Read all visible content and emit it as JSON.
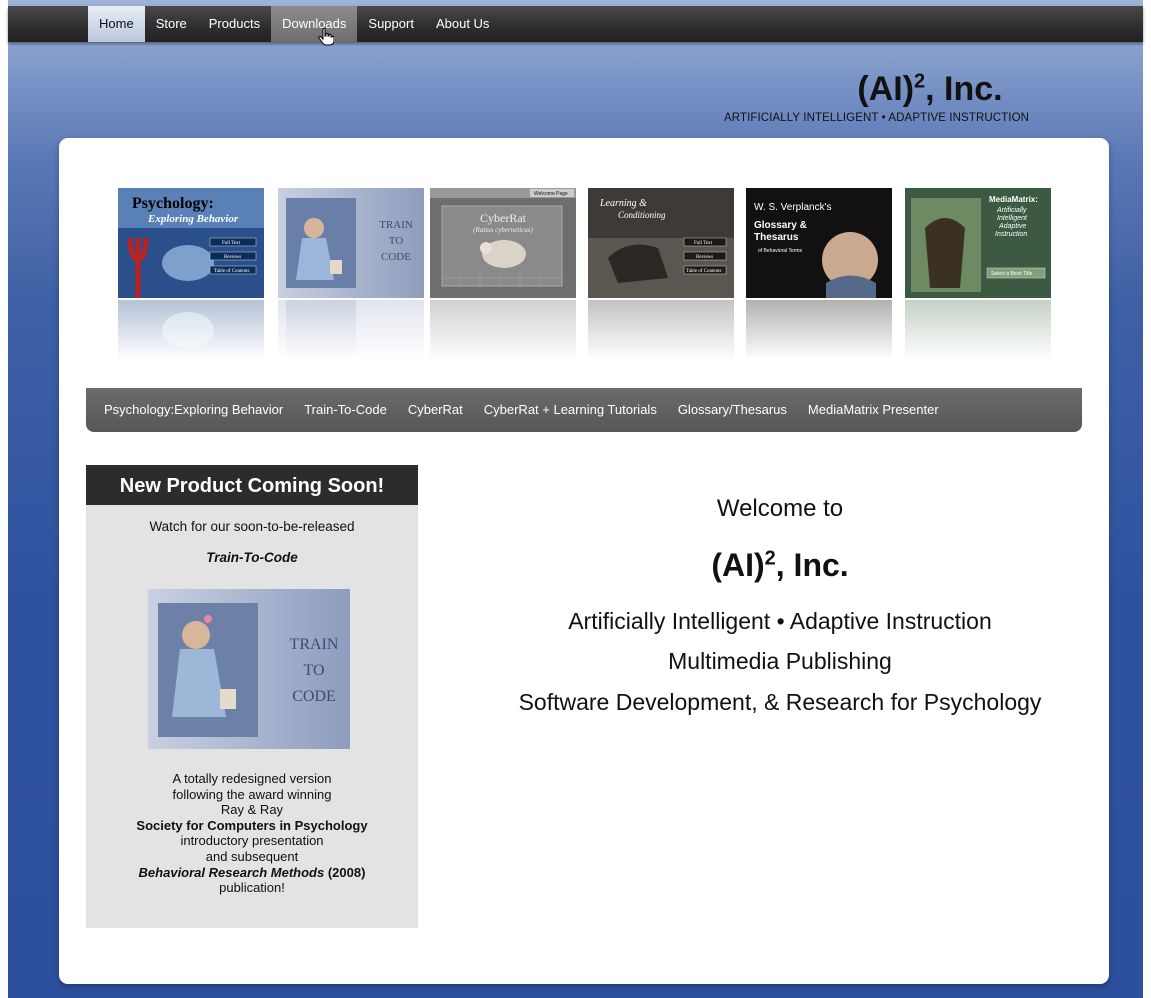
{
  "nav": {
    "items": [
      {
        "label": "Home",
        "state": "active"
      },
      {
        "label": "Store",
        "state": ""
      },
      {
        "label": "Products",
        "state": ""
      },
      {
        "label": "Downloads",
        "state": "hover"
      },
      {
        "label": "Support",
        "state": ""
      },
      {
        "label": "About Us",
        "state": ""
      }
    ]
  },
  "brand": {
    "title_main": "(AI)",
    "title_sup": "2",
    "title_rest": ", Inc.",
    "tagline": "ARTIFICIALLY INTELLIGENT • ADAPTIVE INSTRUCTION"
  },
  "carousel": {
    "cards": [
      {
        "title": "Psychology:",
        "subtitle": "Exploring Behavior",
        "buttons": [
          "Full Text",
          "Reviews",
          "Table of Contents"
        ]
      },
      {
        "title": "TRAIN",
        "line2": "TO",
        "line3": "CODE"
      },
      {
        "title": "CyberRat",
        "subtitle": "(Rattus cyberneticus)",
        "tab": "Welcome Page"
      },
      {
        "title": "Learning &",
        "subtitle": "Conditioning",
        "buttons": [
          "Full Text",
          "Reviews",
          "Table of Contents"
        ]
      },
      {
        "title": "W. S. Verplanck's",
        "line2": "Glossary &",
        "line3": "Thesarus",
        "line4": "of Behavioral Terms"
      },
      {
        "title": "MediaMatrix:",
        "line2": "Artificially",
        "line3": "Intelligent",
        "line4": "Adaptive",
        "line5": "Instruction",
        "button": "Select a Book Title"
      }
    ]
  },
  "products": {
    "items": [
      "Psychology:Exploring Behavior",
      "Train-To-Code",
      "CyberRat",
      "CyberRat + Learning Tutorials",
      "Glossary/Thesarus",
      "MediaMatrix Presenter"
    ]
  },
  "promo": {
    "heading": "New Product Coming Soon!",
    "watch": "Watch for our soon-to-be-released",
    "product_name": "Train-To-Code",
    "image_lines": [
      "TRAIN",
      "TO",
      "CODE"
    ],
    "desc_1": "A totally redesigned version",
    "desc_2": "following the award winning",
    "desc_3": "Ray & Ray",
    "desc_4": "Society for Computers in Psychology",
    "desc_5": "introductory presentation",
    "desc_6": "and subsequent",
    "desc_7": "Behavioral Research Methods",
    "desc_7b": " (2008)",
    "desc_8": "publication!"
  },
  "welcome": {
    "line1": "Welcome to",
    "title_main": "(AI)",
    "title_sup": "2",
    "title_rest": ", Inc.",
    "line3": "Artificially Intelligent • Adaptive Instruction",
    "line4": "Multimedia Publishing",
    "line5": "Software Development, & Research for Psychology"
  },
  "colors": {
    "nav_bg": "#2d2d2d",
    "page_bg": "#2f52a0",
    "product_bar": "#5e5e5e",
    "promo_bg": "#e3e3e3",
    "promo_head": "#2c2c2c"
  }
}
